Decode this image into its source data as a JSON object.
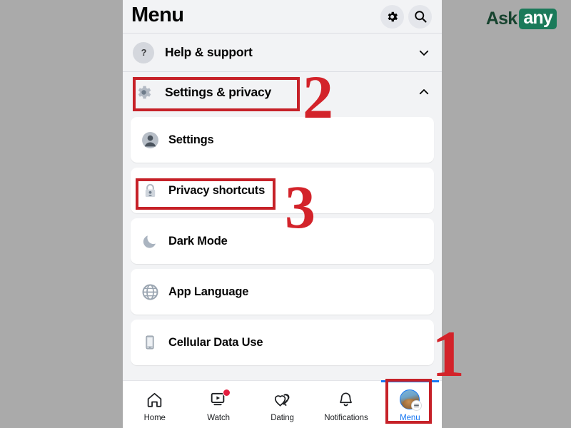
{
  "colors": {
    "background": "#aaaaaa",
    "screen_bg": "#f2f3f5",
    "card_bg": "#ffffff",
    "annotation_red": "#c62128",
    "accent_blue": "#1877f2",
    "badge_red": "#e41e3f",
    "logo_green": "#1b7a5a",
    "logo_dark_green": "#17432f"
  },
  "watermark": {
    "ask": "Ask",
    "any": "any"
  },
  "header": {
    "title": "Menu",
    "gear_icon": "gear-icon",
    "search_icon": "search-icon"
  },
  "collapsibles": [
    {
      "label": "Help & support",
      "icon": "question-mark-icon",
      "chevron": "chevron-down-icon",
      "expanded": false
    },
    {
      "label": "Settings & privacy",
      "icon": "gear-icon",
      "chevron": "chevron-up-icon",
      "expanded": true
    }
  ],
  "settings_items": [
    {
      "label": "Settings",
      "icon": "person-circle-icon"
    },
    {
      "label": "Privacy shortcuts",
      "icon": "lock-icon"
    },
    {
      "label": "Dark Mode",
      "icon": "moon-icon"
    },
    {
      "label": "App Language",
      "icon": "globe-icon"
    },
    {
      "label": "Cellular Data Use",
      "icon": "phone-icon"
    }
  ],
  "bottom_nav": [
    {
      "label": "Home",
      "icon": "home-icon",
      "active": false,
      "badge": false
    },
    {
      "label": "Watch",
      "icon": "watch-play-icon",
      "active": false,
      "badge": true
    },
    {
      "label": "Dating",
      "icon": "dating-hearts-icon",
      "active": false,
      "badge": false
    },
    {
      "label": "Notifications",
      "icon": "bell-icon",
      "active": false,
      "badge": false
    },
    {
      "label": "Menu",
      "icon": "avatar-menu-icon",
      "active": true,
      "badge": false
    }
  ],
  "annotations": [
    {
      "number": "1",
      "target": "menu-tab"
    },
    {
      "number": "2",
      "target": "settings-and-privacy-row"
    },
    {
      "number": "3",
      "target": "privacy-shortcuts-item"
    }
  ]
}
